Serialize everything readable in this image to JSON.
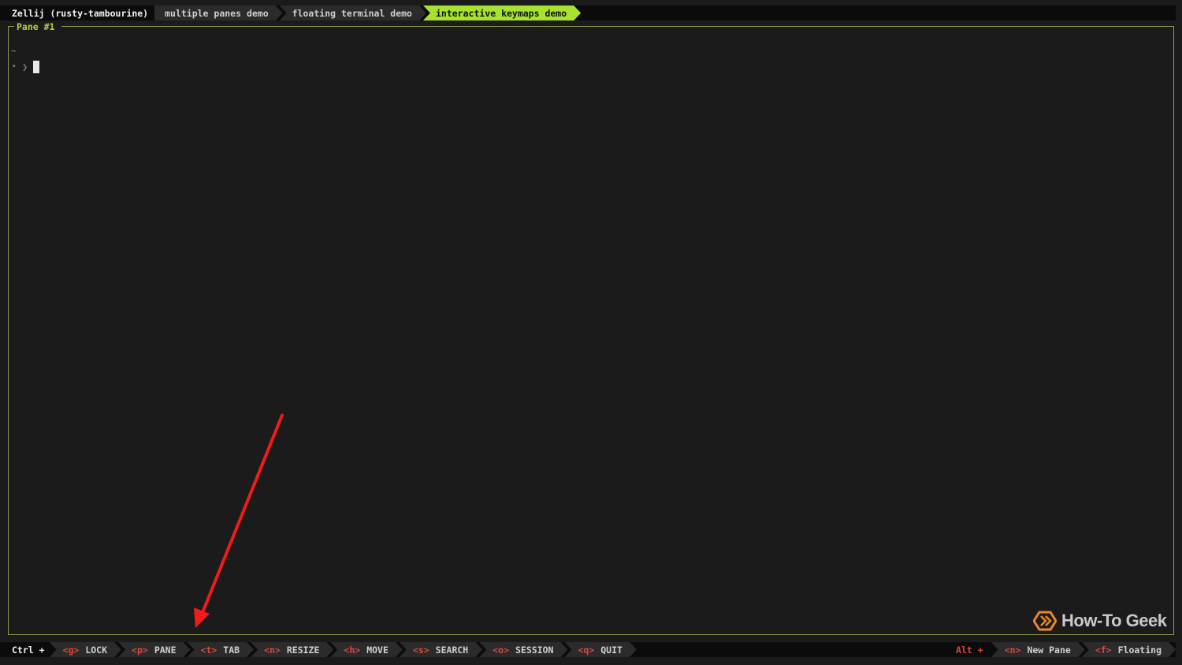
{
  "session": {
    "name": "Zellij (rusty-tambourine)"
  },
  "tabs": [
    {
      "label": "multiple panes demo",
      "active": false
    },
    {
      "label": "floating terminal demo",
      "active": false
    },
    {
      "label": "interactive keymaps demo",
      "active": true
    }
  ],
  "pane": {
    "title": "Pane #1",
    "tilde": "~",
    "prompt_dot": "•",
    "prompt_symbol": "❯"
  },
  "statusbar": {
    "ctrl_label": "Ctrl +",
    "modes": [
      {
        "key": "<g>",
        "label": "LOCK"
      },
      {
        "key": "<p>",
        "label": "PANE"
      },
      {
        "key": "<t>",
        "label": "TAB"
      },
      {
        "key": "<n>",
        "label": "RESIZE"
      },
      {
        "key": "<h>",
        "label": "MOVE"
      },
      {
        "key": "<s>",
        "label": "SEARCH"
      },
      {
        "key": "<o>",
        "label": "SESSION"
      },
      {
        "key": "<q>",
        "label": "QUIT"
      }
    ],
    "alt_label": "Alt +",
    "alt_actions": [
      {
        "key": "<n>",
        "label": "New Pane"
      },
      {
        "key": "<f>",
        "label": "Floating"
      }
    ]
  },
  "watermark": {
    "text": "How-To Geek"
  },
  "colors": {
    "active_tab": "#a6e22e",
    "key_hint": "#e0473b",
    "pane_title": "#b5d13f",
    "annotation_arrow": "#ee1c1c"
  },
  "icons": {
    "annotation": "arrow-icon",
    "watermark": "htg-logo-icon"
  }
}
